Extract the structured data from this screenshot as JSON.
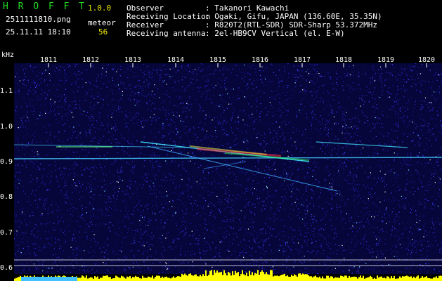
{
  "header": {
    "app_name": "H R O F F T",
    "version": "1.0.0",
    "filename": "2511111810.png",
    "meteor_label": "meteor",
    "timestamp": "25.11.11 18:10",
    "meteor_count": "56"
  },
  "info": {
    "observer_label": "Observer",
    "observer_value": ": Takanori Kawachi",
    "location_label": "Receiving Location",
    "location_value": ": Ogaki, Gifu, JAPAN (136.60E, 35.35N)",
    "receiver_label": "Receiver",
    "receiver_value": ": R820T2(RTL-SDR) SDR-Sharp 53.372MHz",
    "antenna_label": "Receiving antenna",
    "antenna_value": ": 2el-HB9CV Vertical (el. E-W)"
  },
  "axes": {
    "y_unit": "kHz",
    "x_ticks": [
      "1811",
      "1812",
      "1813",
      "1814",
      "1815",
      "1816",
      "1817",
      "1818",
      "1819",
      "1820"
    ],
    "y_ticks": [
      "1.1",
      "1.0",
      "0.9",
      "0.8",
      "0.7",
      "0.6"
    ]
  },
  "colors": {
    "background": "#000000",
    "noise": "#1a1a8c",
    "logo": "#22e020",
    "signal_bar_yellow": "#ffff00",
    "signal_bar_cyan": "#40c0ff"
  }
}
